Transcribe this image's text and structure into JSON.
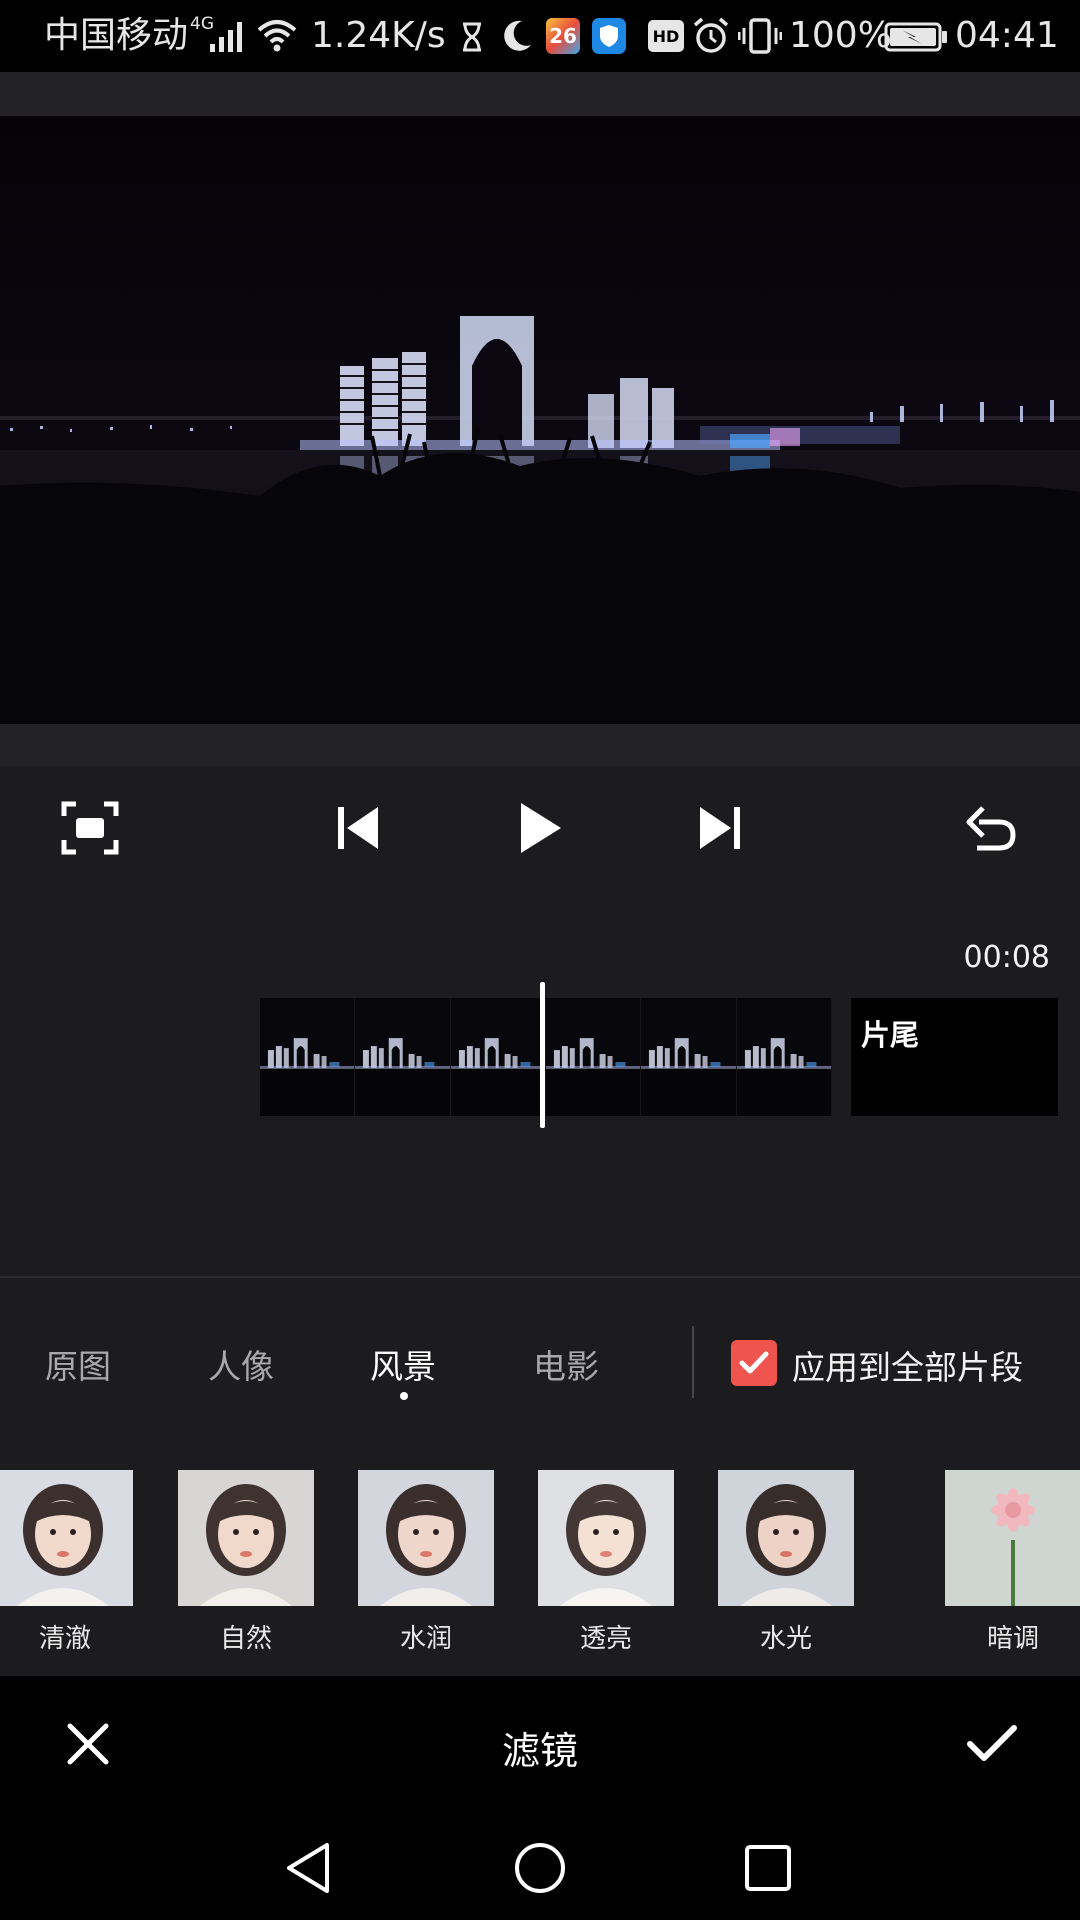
{
  "status_bar": {
    "carrier": "中国移动",
    "network": "4G",
    "speed": "1.24K/s",
    "calendar_day": "26",
    "hd_badge": "HD",
    "battery_percent": "100%",
    "time": "04:41"
  },
  "timeline": {
    "current_time": "00:08",
    "tail_label": "片尾",
    "playhead_position": 0.49
  },
  "categories": {
    "tabs": [
      "原图",
      "人像",
      "风景",
      "电影"
    ],
    "active_index": 2,
    "apply_all_label": "应用到全部片段",
    "apply_all_checked": true
  },
  "filters": {
    "items": [
      "清澈",
      "自然",
      "水润",
      "透亮",
      "水光",
      "暗调"
    ]
  },
  "bottom_bar": {
    "title": "滤镜"
  },
  "colors": {
    "accent": "#f0544f",
    "background": "#1c1c1e",
    "status_bar": "#000000"
  },
  "icons": {
    "fullscreen": "fullscreen-icon",
    "previous": "skip-previous-icon",
    "play": "play-icon",
    "next": "skip-next-icon",
    "undo": "undo-icon",
    "cancel": "close-icon",
    "confirm": "check-icon",
    "nav_back": "nav-back-icon",
    "nav_home": "nav-home-icon",
    "nav_recent": "nav-recent-icon"
  }
}
